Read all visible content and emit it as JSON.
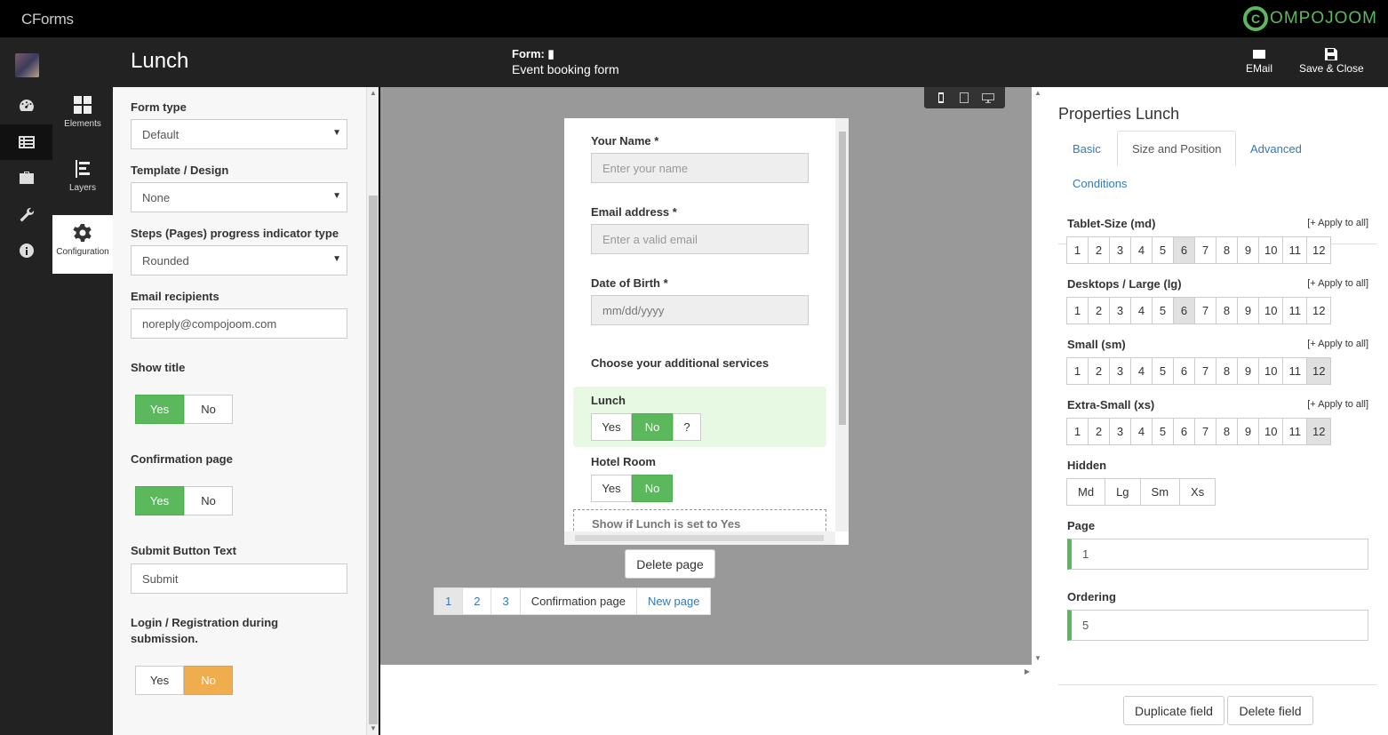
{
  "app": {
    "brand": "CForms",
    "logo_text": "OMPOJOOM",
    "logo_mark": "C"
  },
  "header": {
    "title": "Lunch",
    "form_label": "Form:",
    "form_name": "Event booking form",
    "email_label": "EMail",
    "save_close_label": "Save & Close"
  },
  "sidetabs": [
    {
      "label": "Elements"
    },
    {
      "label": "Layers"
    },
    {
      "label": "Configuration"
    }
  ],
  "config": {
    "form_type": {
      "label": "Form type",
      "value": "Default"
    },
    "template": {
      "label": "Template / Design",
      "value": "None"
    },
    "steps": {
      "label": "Steps (Pages) progress indicator type",
      "value": "Rounded"
    },
    "email": {
      "label": "Email recipients",
      "value": "noreply@compojoom.com"
    },
    "show_title": {
      "label": "Show title",
      "yes": "Yes",
      "no": "No",
      "selected": "Yes"
    },
    "confirmation": {
      "label": "Confirmation page",
      "yes": "Yes",
      "no": "No",
      "selected": "Yes"
    },
    "submit_text": {
      "label": "Submit Button Text",
      "value": "Submit"
    },
    "login": {
      "label": "Login / Registration during submission.",
      "yes": "Yes",
      "no": "No",
      "selected": "No"
    }
  },
  "form_preview": {
    "name": {
      "label": "Your Name *",
      "placeholder": "Enter your name"
    },
    "email": {
      "label": "Email address *",
      "placeholder": "Enter a valid email"
    },
    "dob": {
      "label": "Date of Birth *",
      "placeholder": "mm/dd/yyyy"
    },
    "services_heading": "Choose your additional services",
    "lunch": {
      "label": "Lunch",
      "yes": "Yes",
      "no": "No",
      "q": "?",
      "selected": "No"
    },
    "hotel": {
      "label": "Hotel Room",
      "yes": "Yes",
      "no": "No",
      "selected": "No"
    },
    "condition_text": "Show if Lunch is set to Yes"
  },
  "canvas": {
    "delete_page": "Delete page",
    "pages": [
      "1",
      "2",
      "3"
    ],
    "current_page": "1",
    "confirmation_page": "Confirmation page",
    "new_page": "New page"
  },
  "properties": {
    "title": "Properties Lunch",
    "tabs": [
      "Basic",
      "Size and Position",
      "Advanced",
      "Conditions"
    ],
    "active_tab": "Size and Position",
    "apply_all": "[+ Apply to all]",
    "sizes": [
      {
        "label": "Tablet-Size (md)",
        "selected": "6"
      },
      {
        "label": "Desktops / Large (lg)",
        "selected": "6"
      },
      {
        "label": "Small (sm)",
        "selected": "12"
      },
      {
        "label": "Extra-Small (xs)",
        "selected": "12"
      }
    ],
    "columns": [
      "1",
      "2",
      "3",
      "4",
      "5",
      "6",
      "7",
      "8",
      "9",
      "10",
      "11",
      "12"
    ],
    "hidden": {
      "label": "Hidden",
      "options": [
        "Md",
        "Lg",
        "Sm",
        "Xs"
      ]
    },
    "page": {
      "label": "Page",
      "value": "1"
    },
    "ordering": {
      "label": "Ordering",
      "value": "5"
    },
    "duplicate": "Duplicate field",
    "delete": "Delete field"
  },
  "colors": {
    "accent_green": "#5cb85c",
    "accent_orange": "#f0ad4e",
    "link": "#337ab7",
    "dark": "#222222"
  }
}
